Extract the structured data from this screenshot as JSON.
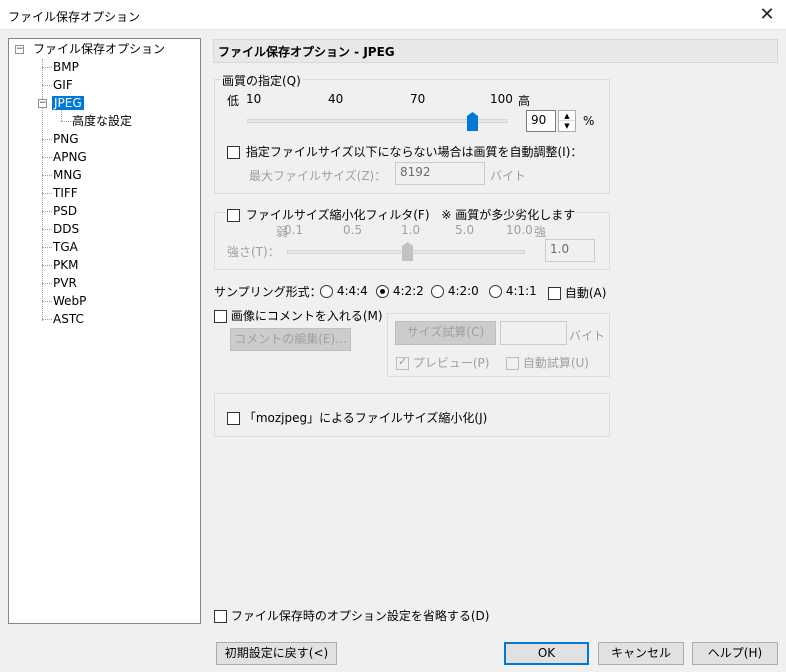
{
  "window": {
    "title": "ファイル保存オプション",
    "close": "✕"
  },
  "tree": {
    "root": "ファイル保存オプション",
    "items": [
      "BMP",
      "GIF",
      "JPEG",
      "高度な設定",
      "PNG",
      "APNG",
      "MNG",
      "TIFF",
      "PSD",
      "DDS",
      "TGA",
      "PKM",
      "PVR",
      "WebP",
      "ASTC"
    ],
    "selected": "JPEG"
  },
  "panel": {
    "header": "ファイル保存オプション - JPEG",
    "quality": {
      "group_title": "画質の指定(Q)",
      "low_label": "低",
      "high_label": "高",
      "ticks": [
        "10",
        "40",
        "70",
        "100"
      ],
      "value": "90",
      "unit": "%",
      "slider_fraction": 0.9
    },
    "autosize": {
      "label": "指定ファイルサイズ以下にならない場合は画質を自動調整(I)：",
      "max_label": "最大ファイルサイズ(Z)：",
      "max_value": "8192",
      "unit": "バイト"
    },
    "filter": {
      "label": "ファイルサイズ縮小化フィルタ(F)",
      "note": "※ 画質が多少劣化します",
      "weak": "弱",
      "strong": "強",
      "ticks": [
        "0.1",
        "0.5",
        "1.0",
        "5.0",
        "10.0"
      ],
      "strength_label": "強さ(T)：",
      "value": "1.0"
    },
    "sampling": {
      "label": "サンプリング形式：",
      "options": [
        "4:4:4",
        "4:2:2",
        "4:2:0",
        "4:1:1"
      ],
      "selected": "4:2:2",
      "auto_label": "自動(A)"
    },
    "comment": {
      "label": "画像にコメントを入れる(M)",
      "edit_button": "コメントの編集(E)..."
    },
    "size_test": {
      "button": "サイズ試算(C)",
      "unit": "バイト",
      "preview_label": "プレビュー(P)",
      "auto_label": "自動試算(U)"
    },
    "mozjpeg": {
      "label": "「mozjpeg」によるファイルサイズ縮小化(J)"
    },
    "skip_option": {
      "label": "ファイル保存時のオプション設定を省略する(D)"
    }
  },
  "buttons": {
    "reset": "初期設定に戻す(<)",
    "ok": "OK",
    "cancel": "キャンセル",
    "help": "ヘルプ(H)"
  }
}
